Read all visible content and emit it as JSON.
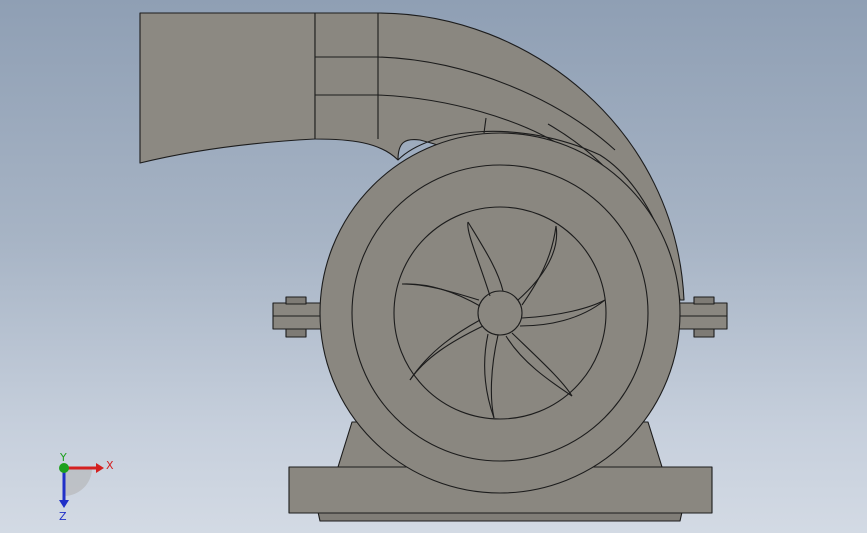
{
  "viewport": {
    "background_top": "#8f9fb4",
    "background_bottom": "#d3dae4"
  },
  "model": {
    "name": "centrifugal-pump",
    "fill_color": "#8a8780",
    "edge_color": "#1c1c1c",
    "impeller_blade_count": 7
  },
  "triad": {
    "x_label": "X",
    "y_label": "Y",
    "z_label": "Z",
    "x_color": "#d42020",
    "y_color": "#1ea01e",
    "z_color": "#2030c8"
  }
}
